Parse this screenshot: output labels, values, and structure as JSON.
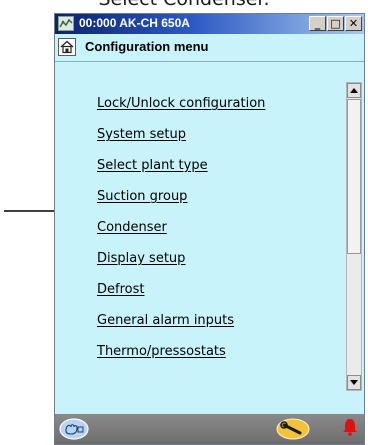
{
  "caption": "Select Condenser.",
  "window": {
    "title": "00:000 AK-CH 650A",
    "buttons": {
      "minimize": "_",
      "maximize": "□",
      "close": "✕"
    }
  },
  "menu": {
    "title": "Configuration menu"
  },
  "items": [
    {
      "label": "Lock/Unlock configuration"
    },
    {
      "label": "System setup"
    },
    {
      "label": "Select plant type"
    },
    {
      "label": "Suction group"
    },
    {
      "label": "Condenser"
    },
    {
      "label": "Display setup"
    },
    {
      "label": "Defrost"
    },
    {
      "label": "General alarm inputs"
    },
    {
      "label": "Thermo/pressostats"
    }
  ],
  "icons": {
    "app": "app-icon",
    "home": "home-icon",
    "hand": "hand-icon",
    "wrench": "wrench-icon",
    "alarm": "bell-icon",
    "pointer": "arrow-icon"
  },
  "colors": {
    "content_bg": "#c8f3fb",
    "titlebar_start": "#0a236d",
    "titlebar_end": "#a9c8ee",
    "statusbar": "#7b7b7b",
    "wrench_badge": "#f2c23a",
    "alarm": "#e01010"
  }
}
